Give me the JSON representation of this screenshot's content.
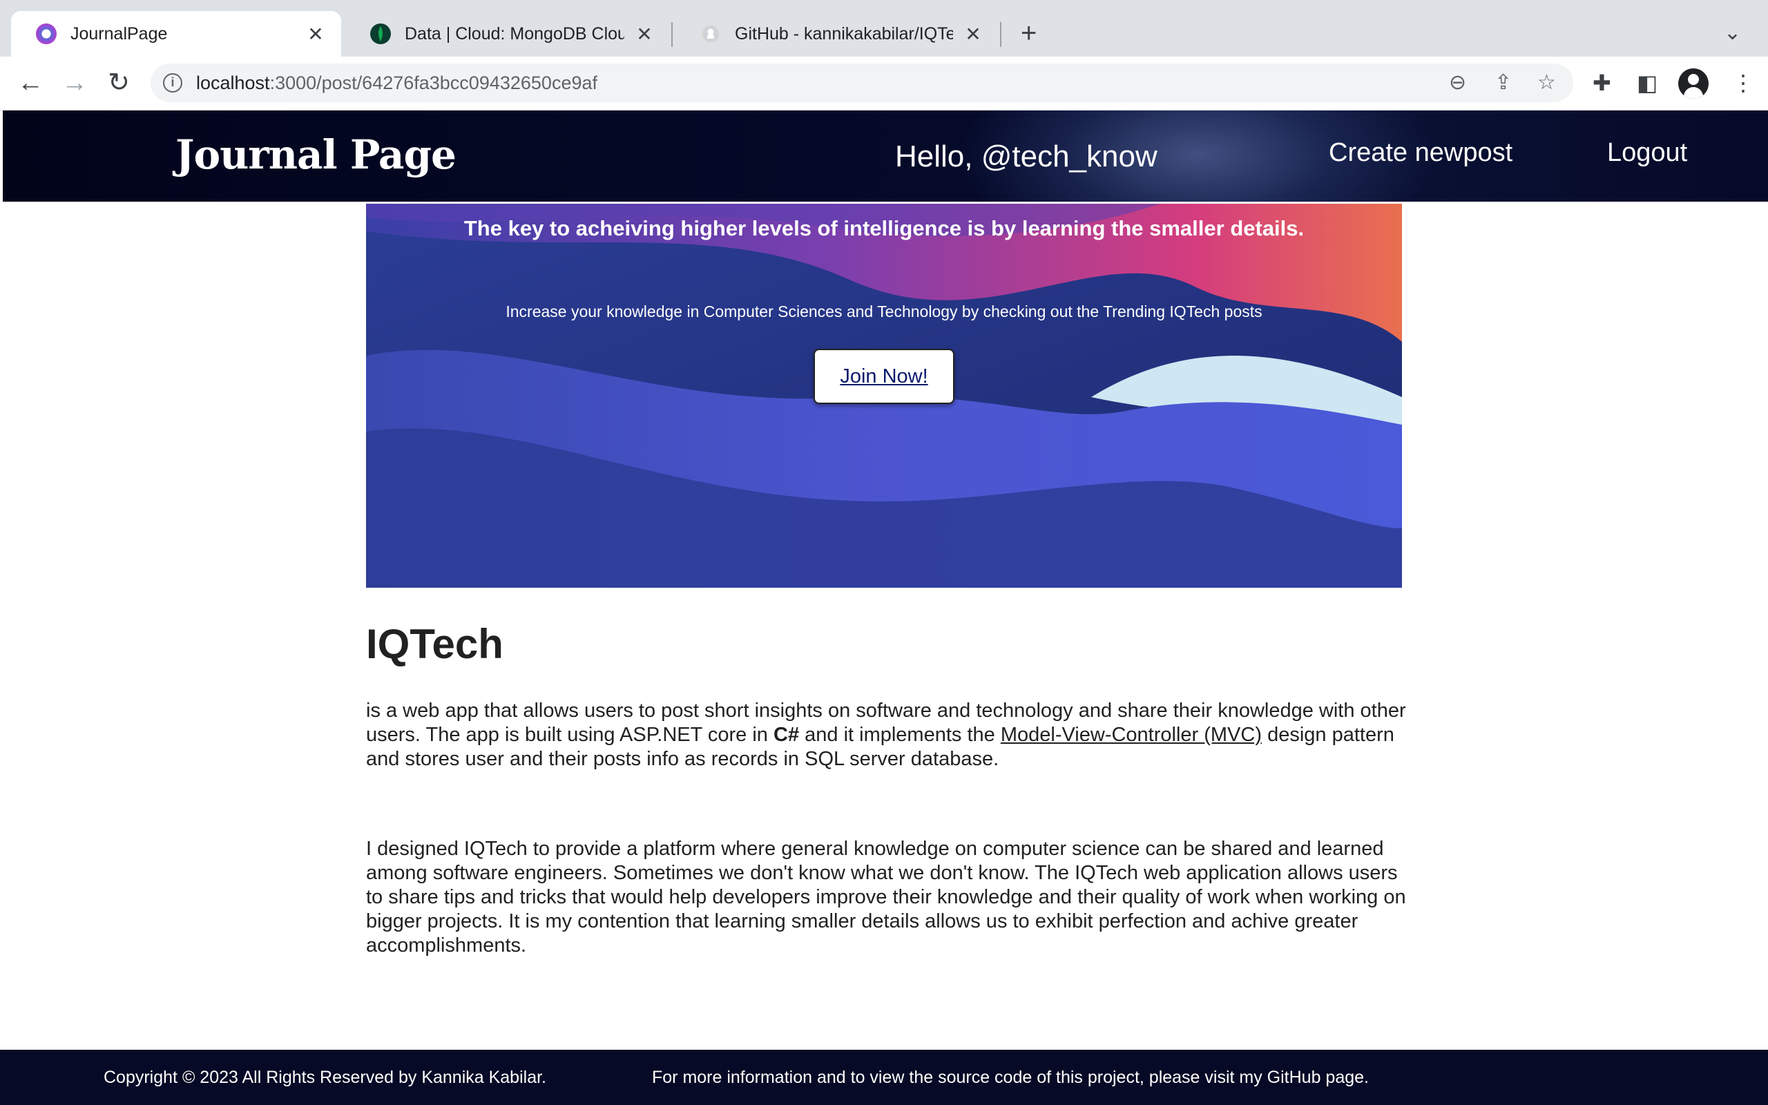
{
  "browser": {
    "tabs": [
      {
        "title": "JournalPage",
        "favicon": "journalpage-favicon",
        "active": true
      },
      {
        "title": "Data | Cloud: MongoDB Cloud",
        "favicon": "mongodb-leaf-icon",
        "active": false
      },
      {
        "title": "GitHub - kannikakabilar/IQTech",
        "favicon": "github-icon",
        "active": false
      }
    ],
    "url_host": "localhost",
    "url_rest": ":3000/post/64276fa3bcc09432650ce9af"
  },
  "header": {
    "logo": "Journal Page",
    "greeting": "Hello, @tech_know",
    "nav": {
      "create": "Create newpost",
      "logout": "Logout"
    }
  },
  "hero": {
    "title": "The key to acheiving higher levels of intelligence is by learning the smaller details.",
    "subtitle": "Increase your knowledge in Computer Sciences and Technology by checking out the Trending IQTech posts",
    "button": "Join Now!"
  },
  "post": {
    "title": "IQTech",
    "para1": {
      "part1": "is a web app that allows users to post short insights on software and technology and share their knowledge with other users. The app is built using ASP.NET core in ",
      "bold": "C#",
      "part2": " and it implements the ",
      "link": "Model-View-Controller (MVC)",
      "part3": " design pattern and stores user and their posts info as records in SQL server database."
    },
    "para2": "I designed IQTech to provide a platform where general knowledge on computer science can be shared and learned among software engineers. Sometimes we don't know what we don't know. The IQTech web application allows users to share tips and tricks that would help developers improve their knowledge and their quality of work when working on bigger projects. It is my contention that learning smaller details allows us to exhibit perfection and achive greater accomplishments."
  },
  "footer": {
    "copyright": "Copyright © 2023 All Rights Reserved by Kannika Kabilar.",
    "info": "For more information and to view the source code of this project, please visit my GitHub page."
  },
  "colors": {
    "header_bg": "#02041a",
    "footer_bg": "#060a26",
    "tabstrip_bg": "#dee1e6"
  }
}
